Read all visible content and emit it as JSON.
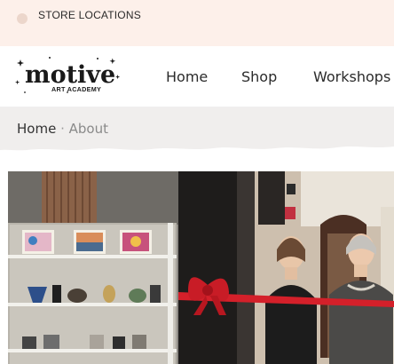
{
  "topbar": {
    "store_locations_label": "STORE LOCATIONS"
  },
  "logo": {
    "name": "motive",
    "tagline": "ART ACADEMY"
  },
  "nav": {
    "items": [
      {
        "label": "Home"
      },
      {
        "label": "Shop"
      },
      {
        "label": "Workshops"
      }
    ]
  },
  "breadcrumb": {
    "home": "Home",
    "separator": " · ",
    "current": "About"
  },
  "colors": {
    "topbar_bg": "#fdf0ea",
    "breadcrumb_bg": "#f0eeed",
    "ribbon_red": "#d4202a"
  }
}
